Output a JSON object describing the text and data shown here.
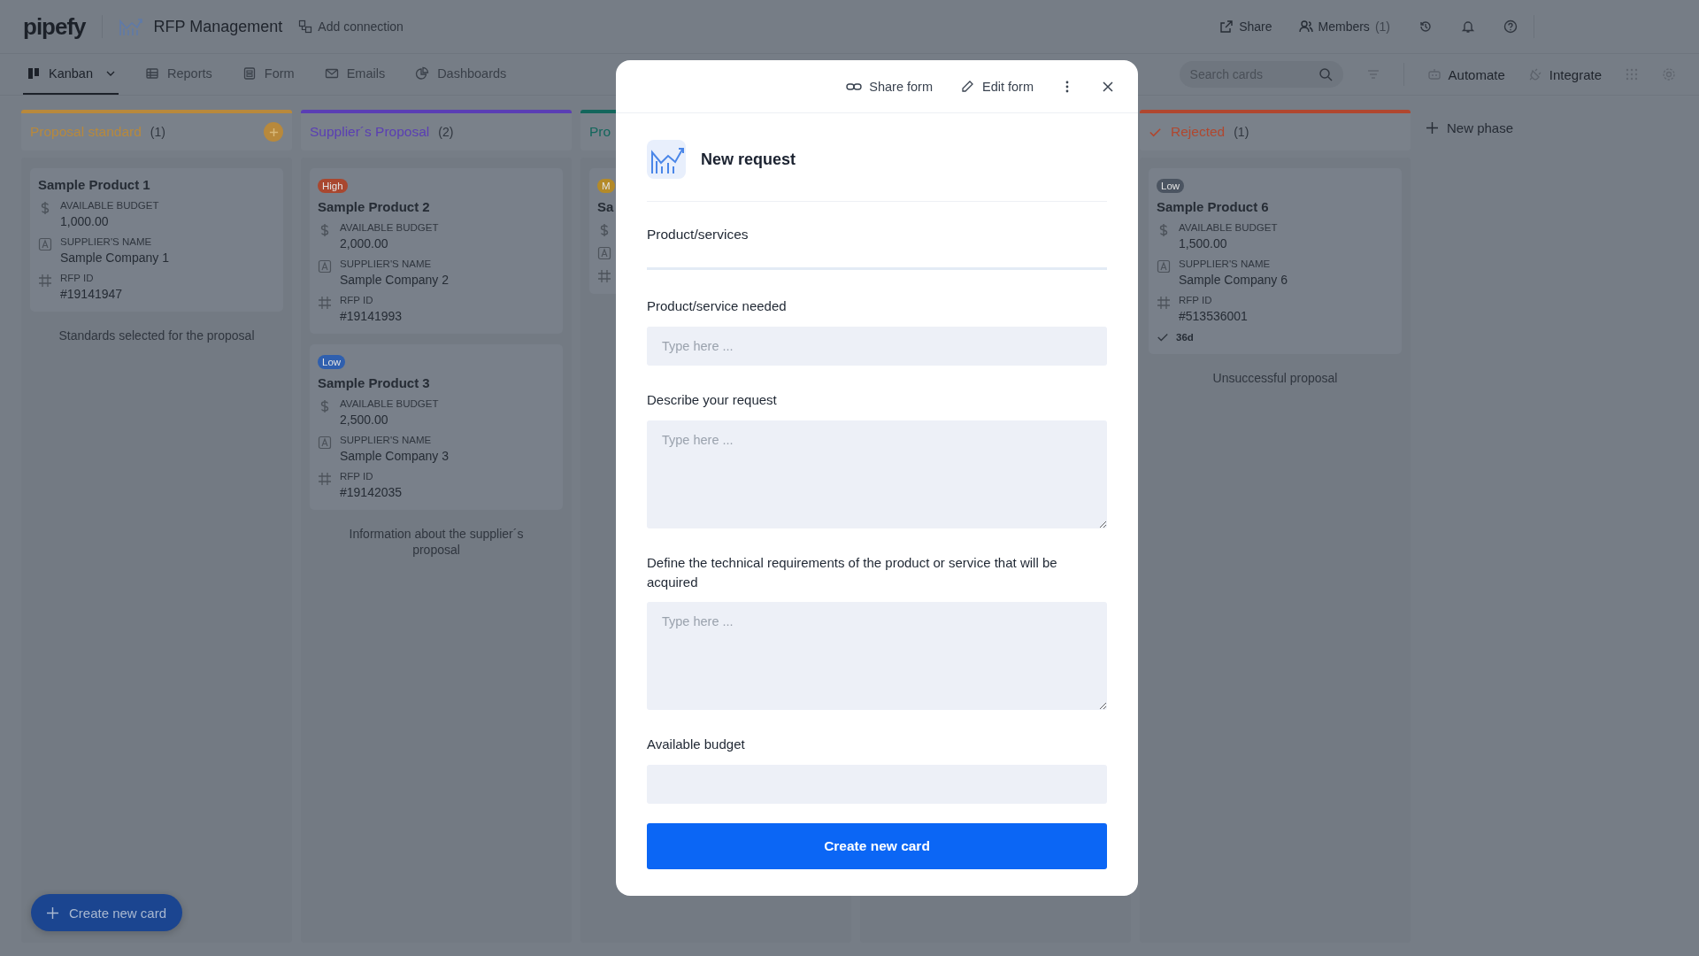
{
  "app": {
    "logo": "pipefy",
    "pipe_title": "RFP Management",
    "add_connection": "Add connection"
  },
  "header_actions": [
    {
      "kind": "share",
      "label": "Share"
    },
    {
      "kind": "members",
      "label": "Members",
      "count": "(1)"
    },
    {
      "kind": "history"
    },
    {
      "kind": "bell"
    },
    {
      "kind": "help"
    }
  ],
  "views": [
    {
      "kind": "kanban",
      "label": "Kanban",
      "selected": true
    },
    {
      "kind": "reports",
      "label": "Reports",
      "selected": false
    },
    {
      "kind": "form",
      "label": "Form",
      "selected": false
    },
    {
      "kind": "emails",
      "label": "Emails",
      "selected": false
    },
    {
      "kind": "dashboards",
      "label": "Dashboards",
      "selected": false
    }
  ],
  "search": {
    "placeholder": "Search cards"
  },
  "tools": [
    {
      "kind": "automate",
      "label": "Automate"
    },
    {
      "kind": "integrate",
      "label": "Integrate"
    }
  ],
  "phases": [
    {
      "title": "Proposal standard",
      "count": "(1)",
      "color": "#b8893c",
      "add_button": true,
      "final": false,
      "description": "Standards selected for the proposal",
      "cards": [
        {
          "title": "Sample Product 1",
          "fields": [
            {
              "kind": "currency",
              "label": "AVAILABLE BUDGET",
              "value": "1,000.00"
            },
            {
              "kind": "text",
              "label": "SUPPLIER'S NAME",
              "value": "Sample Company 1"
            },
            {
              "kind": "id",
              "label": "RFP ID",
              "value": "#19141947"
            }
          ]
        }
      ]
    },
    {
      "title": "Supplier´s Proposal",
      "count": "(2)",
      "color": "#5a3eb4",
      "add_button": false,
      "final": false,
      "description": "Information about the supplier´s proposal",
      "cards": [
        {
          "badge": {
            "label": "High",
            "color": "#a9472f"
          },
          "title": "Sample Product 2",
          "fields": [
            {
              "kind": "currency",
              "label": "AVAILABLE BUDGET",
              "value": "2,000.00"
            },
            {
              "kind": "text",
              "label": "SUPPLIER'S NAME",
              "value": "Sample Company 2"
            },
            {
              "kind": "id",
              "label": "RFP ID",
              "value": "#19141993"
            }
          ]
        },
        {
          "badge": {
            "label": "Low",
            "color": "#2f5fae"
          },
          "title": "Sample Product 3",
          "fields": [
            {
              "kind": "currency",
              "label": "AVAILABLE BUDGET",
              "value": "2,500.00"
            },
            {
              "kind": "text",
              "label": "SUPPLIER'S NAME",
              "value": "Sample Company 3"
            },
            {
              "kind": "id",
              "label": "RFP ID",
              "value": "#19142035"
            }
          ]
        }
      ]
    },
    {
      "title": "Pro",
      "color": "#13665c",
      "cards": [
        {
          "badge": {
            "label": "M",
            "color": "#b48a28"
          },
          "title": "Sa",
          "fields": [
            {
              "kind": "currency"
            },
            {
              "kind": "text"
            },
            {
              "kind": "id"
            }
          ]
        }
      ]
    },
    {
      "title": "Rejected",
      "count": "(1)",
      "color": "#b0472f",
      "add_button": false,
      "final": true,
      "description": "Unsuccessful proposal",
      "cards": [
        {
          "badge": {
            "label": "Low",
            "color": "#4b5461"
          },
          "title": "Sample Product 6",
          "fields": [
            {
              "kind": "currency",
              "label": "AVAILABLE BUDGET",
              "value": "1,500.00"
            },
            {
              "kind": "text",
              "label": "SUPPLIER'S NAME",
              "value": "Sample Company 6"
            },
            {
              "kind": "id",
              "label": "RFP ID",
              "value": "#513536001"
            }
          ],
          "age": "36d"
        }
      ]
    }
  ],
  "new_phase": "New phase",
  "create_card_button": "Create new card",
  "modal": {
    "actions": [
      {
        "kind": "share",
        "label": "Share form"
      },
      {
        "kind": "edit",
        "label": "Edit form"
      },
      {
        "kind": "more"
      },
      {
        "kind": "close"
      }
    ],
    "title": "New request",
    "section": "Product/services",
    "fields": [
      {
        "kind": "input",
        "label": "Product/service needed",
        "placeholder": "Type here ..."
      },
      {
        "kind": "textarea",
        "label": "Describe your request",
        "placeholder": "Type here ..."
      },
      {
        "kind": "textarea",
        "label": "Define the technical requirements of the product or service that will be acquired",
        "placeholder": "Type here ..."
      },
      {
        "kind": "input",
        "label": "Available budget"
      }
    ],
    "submit": "Create new card"
  }
}
